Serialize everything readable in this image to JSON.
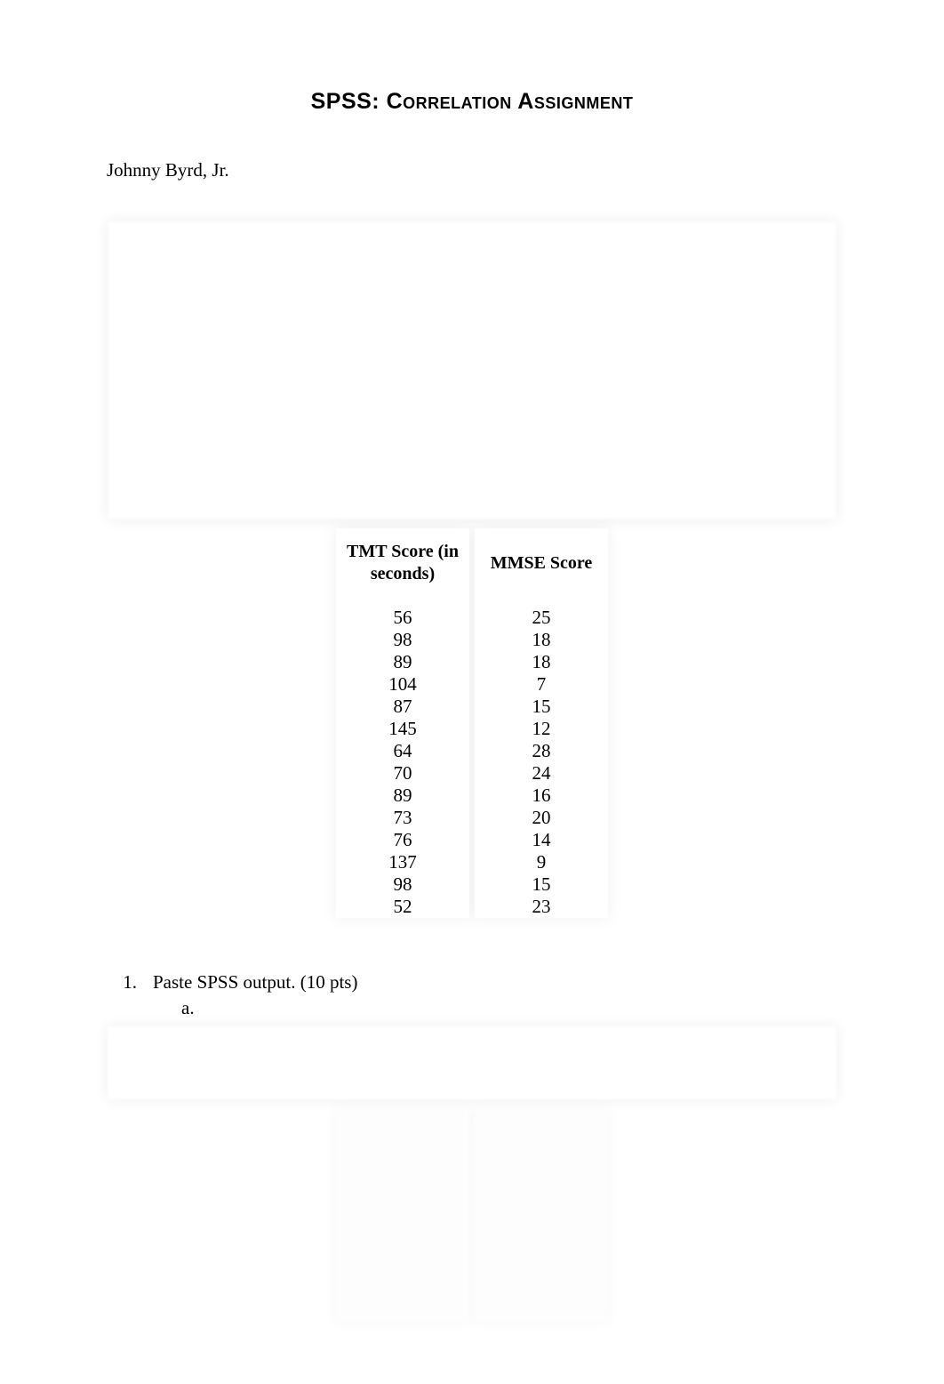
{
  "title": "SPSS: Correlation Assignment",
  "author": "Johnny Byrd, Jr.",
  "table": {
    "headers": {
      "col1": "TMT Score (in seconds)",
      "col2": "MMSE Score"
    },
    "rows": [
      {
        "tmt": "56",
        "mmse": "25"
      },
      {
        "tmt": "98",
        "mmse": "18"
      },
      {
        "tmt": "89",
        "mmse": "18"
      },
      {
        "tmt": "104",
        "mmse": "7"
      },
      {
        "tmt": "87",
        "mmse": "15"
      },
      {
        "tmt": "145",
        "mmse": "12"
      },
      {
        "tmt": "64",
        "mmse": "28"
      },
      {
        "tmt": "70",
        "mmse": "24"
      },
      {
        "tmt": "89",
        "mmse": "16"
      },
      {
        "tmt": "73",
        "mmse": "20"
      },
      {
        "tmt": "76",
        "mmse": "14"
      },
      {
        "tmt": "137",
        "mmse": "9"
      },
      {
        "tmt": "98",
        "mmse": "15"
      },
      {
        "tmt": "52",
        "mmse": "23"
      }
    ]
  },
  "question": {
    "number": "1.",
    "text": "Paste SPSS output.  (10 pts)",
    "sub": "a."
  }
}
